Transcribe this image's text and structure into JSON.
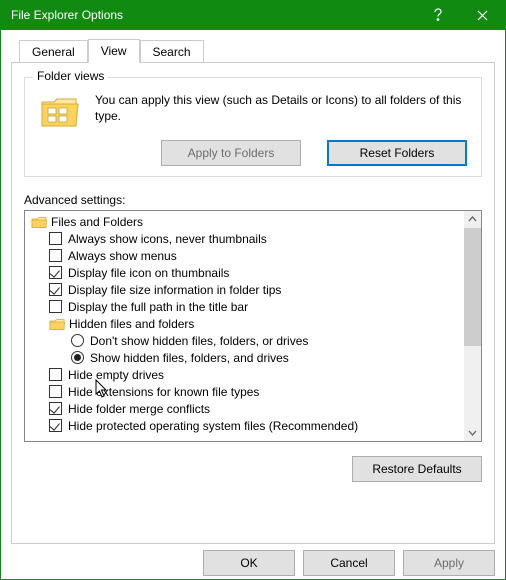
{
  "window": {
    "title": "File Explorer Options"
  },
  "tabs": {
    "general": "General",
    "view": "View",
    "search": "Search"
  },
  "folderViews": {
    "legend": "Folder views",
    "text": "You can apply this view (such as Details or Icons) to all folders of this type.",
    "applyBtn": "Apply to Folders",
    "resetBtn": "Reset Folders"
  },
  "advanced": {
    "label": "Advanced settings:",
    "header": "Files and Folders",
    "items": [
      {
        "kind": "check",
        "checked": false,
        "label": "Always show icons, never thumbnails"
      },
      {
        "kind": "check",
        "checked": false,
        "label": "Always show menus"
      },
      {
        "kind": "check",
        "checked": true,
        "label": "Display file icon on thumbnails"
      },
      {
        "kind": "check",
        "checked": true,
        "label": "Display file size information in folder tips"
      },
      {
        "kind": "check",
        "checked": false,
        "label": "Display the full path in the title bar"
      },
      {
        "kind": "folder",
        "label": "Hidden files and folders"
      },
      {
        "kind": "radio",
        "selected": false,
        "label": "Don't show hidden files, folders, or drives"
      },
      {
        "kind": "radio",
        "selected": true,
        "label": "Show hidden files, folders, and drives"
      },
      {
        "kind": "check",
        "checked": false,
        "label": "Hide empty drives"
      },
      {
        "kind": "check",
        "checked": false,
        "label": "Hide extensions for known file types"
      },
      {
        "kind": "check",
        "checked": true,
        "label": "Hide folder merge conflicts"
      },
      {
        "kind": "check",
        "checked": true,
        "label": "Hide protected operating system files (Recommended)"
      }
    ],
    "restoreBtn": "Restore Defaults"
  },
  "dialogButtons": {
    "ok": "OK",
    "cancel": "Cancel",
    "apply": "Apply"
  }
}
